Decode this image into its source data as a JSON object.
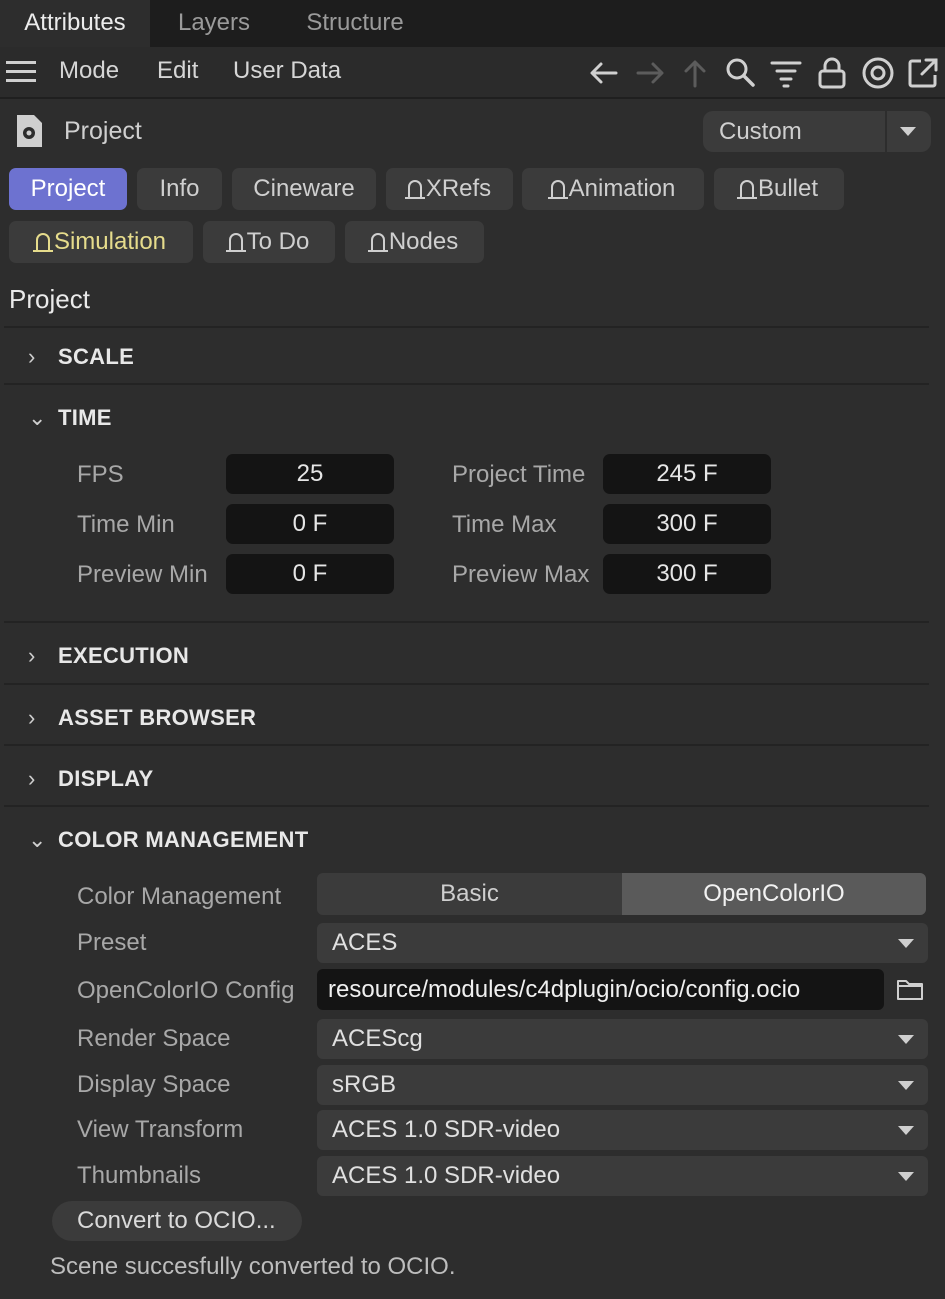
{
  "tabs": [
    "Attributes",
    "Layers",
    "Structure"
  ],
  "menu": {
    "items": [
      "Mode",
      "Edit",
      "User Data"
    ]
  },
  "toolbar_icons": [
    "back-arrow-icon",
    "forward-arrow-icon",
    "up-arrow-icon",
    "search-icon",
    "filter-icon",
    "lock-icon",
    "target-icon",
    "new-window-icon"
  ],
  "object": {
    "name": "Project",
    "preset": "Custom"
  },
  "tabs_row1": [
    "Project",
    "Info",
    "Cineware",
    "XRefs",
    "Animation",
    "Bullet"
  ],
  "tabs_row2": [
    "Simulation",
    "To Do",
    "Nodes"
  ],
  "section_title": "Project",
  "groups": {
    "scale": "SCALE",
    "time": "TIME",
    "execution": "EXECUTION",
    "asset_browser": "ASSET BROWSER",
    "display": "DISPLAY",
    "color_management": "COLOR MANAGEMENT"
  },
  "time": {
    "fps_label": "FPS",
    "fps": "25",
    "project_time_label": "Project Time",
    "project_time": "245 F",
    "time_min_label": "Time Min",
    "time_min": "0 F",
    "time_max_label": "Time Max",
    "time_max": "300 F",
    "preview_min_label": "Preview Min",
    "preview_min": "0 F",
    "preview_max_label": "Preview Max",
    "preview_max": "300 F"
  },
  "color": {
    "cm_label": "Color Management",
    "cm_options": [
      "Basic",
      "OpenColorIO"
    ],
    "cm_selected": "OpenColorIO",
    "preset_label": "Preset",
    "preset": "ACES",
    "config_label": "OpenColorIO Config",
    "config": "resource/modules/c4dplugin/ocio/config.ocio",
    "render_label": "Render Space",
    "render": "ACEScg",
    "display_label": "Display Space",
    "display": "sRGB",
    "view_label": "View Transform",
    "view": "ACES 1.0 SDR-video",
    "thumb_label": "Thumbnails",
    "thumb": "ACES 1.0 SDR-video",
    "convert_button": "Convert to OCIO...",
    "status": "Scene succesfully converted to OCIO."
  },
  "colors": {
    "accent": "#6d72d0",
    "highlight_text": "#e6dc8c"
  }
}
